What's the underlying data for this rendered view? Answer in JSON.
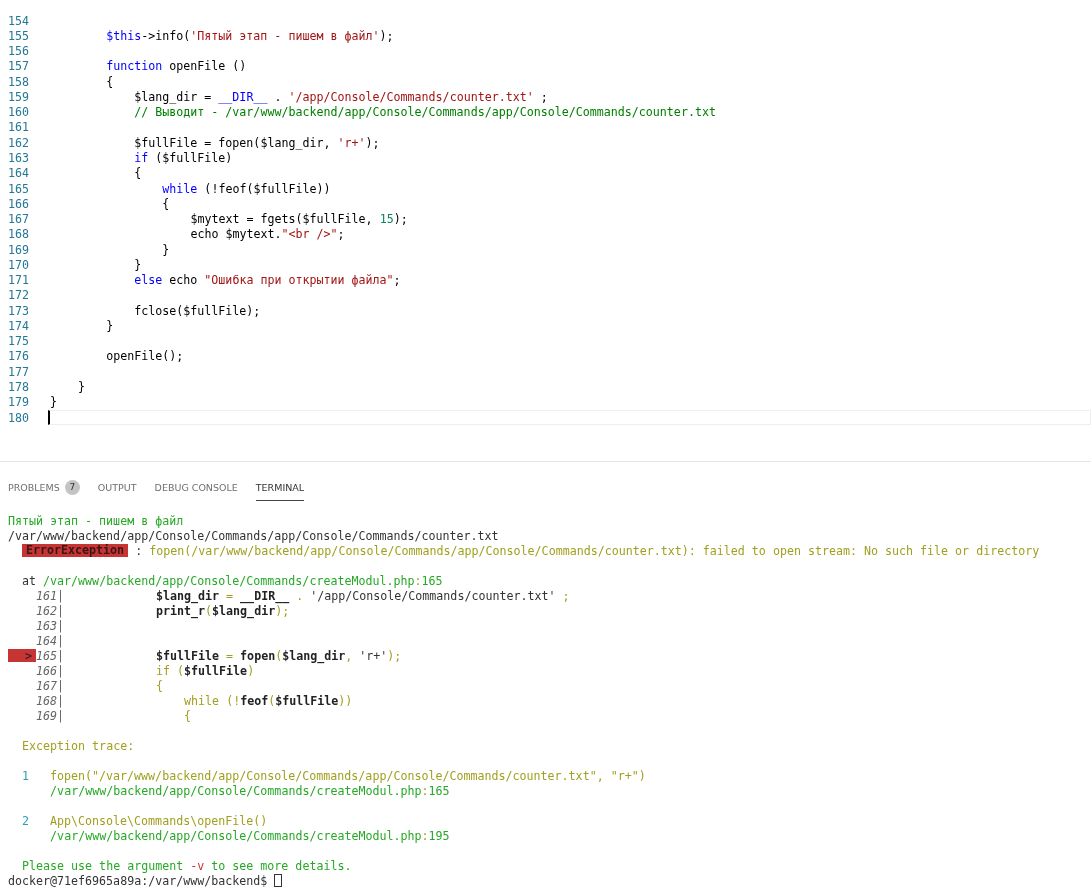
{
  "editor": {
    "lines": [
      {
        "number": "154",
        "current": false
      },
      {
        "number": "155",
        "current": false,
        "tokens": [
          {
            "text": "        $this",
            "kind": "keyword"
          },
          {
            "text": "->info(",
            "kind": "plain"
          },
          {
            "text": "'Пятый этап - пишем в файл'",
            "kind": "string"
          },
          {
            "text": ");",
            "kind": "plain"
          }
        ]
      },
      {
        "number": "156",
        "current": false
      },
      {
        "number": "157",
        "current": false,
        "tokens": [
          {
            "text": "        function",
            "kind": "keyword"
          },
          {
            "text": " openFile ()",
            "kind": "plain"
          }
        ]
      },
      {
        "number": "158",
        "current": false,
        "tokens": [
          {
            "text": "        {",
            "kind": "plain"
          }
        ]
      },
      {
        "number": "159",
        "current": false,
        "tokens": [
          {
            "text": "            $lang_dir = ",
            "kind": "plain"
          },
          {
            "text": "__DIR__",
            "kind": "keyword"
          },
          {
            "text": " . ",
            "kind": "plain"
          },
          {
            "text": "'/app/Console/Commands/counter.txt'",
            "kind": "string"
          },
          {
            "text": " ;",
            "kind": "plain"
          }
        ]
      },
      {
        "number": "160",
        "current": false,
        "tokens": [
          {
            "text": "            // Выводит - /var/www/backend/app/Console/Commands/app/Console/Commands/counter.txt",
            "kind": "comment"
          }
        ]
      },
      {
        "number": "161",
        "current": false
      },
      {
        "number": "162",
        "current": false,
        "tokens": [
          {
            "text": "            $fullFile = fopen($lang_dir, ",
            "kind": "plain"
          },
          {
            "text": "'r+'",
            "kind": "string"
          },
          {
            "text": ");",
            "kind": "plain"
          }
        ]
      },
      {
        "number": "163",
        "current": false,
        "tokens": [
          {
            "text": "            if",
            "kind": "keyword"
          },
          {
            "text": " ($fullFile)",
            "kind": "plain"
          }
        ]
      },
      {
        "number": "164",
        "current": false,
        "tokens": [
          {
            "text": "            {",
            "kind": "plain"
          }
        ]
      },
      {
        "number": "165",
        "current": false,
        "tokens": [
          {
            "text": "                while",
            "kind": "keyword"
          },
          {
            "text": " (!feof($fullFile))",
            "kind": "plain"
          }
        ]
      },
      {
        "number": "166",
        "current": false,
        "tokens": [
          {
            "text": "                {",
            "kind": "plain"
          }
        ]
      },
      {
        "number": "167",
        "current": false,
        "tokens": [
          {
            "text": "                    $mytext = fgets($fullFile, ",
            "kind": "plain"
          },
          {
            "text": "15",
            "kind": "number"
          },
          {
            "text": ");",
            "kind": "plain"
          }
        ]
      },
      {
        "number": "168",
        "current": false,
        "tokens": [
          {
            "text": "                    echo $mytext.",
            "kind": "plain"
          },
          {
            "text": "\"<br />\"",
            "kind": "string"
          },
          {
            "text": ";",
            "kind": "plain"
          }
        ]
      },
      {
        "number": "169",
        "current": false,
        "tokens": [
          {
            "text": "                }",
            "kind": "plain"
          }
        ]
      },
      {
        "number": "170",
        "current": false,
        "tokens": [
          {
            "text": "            }",
            "kind": "plain"
          }
        ]
      },
      {
        "number": "171",
        "current": false,
        "tokens": [
          {
            "text": "            else",
            "kind": "keyword"
          },
          {
            "text": " echo ",
            "kind": "plain"
          },
          {
            "text": "\"Ошибка при открытии файла\"",
            "kind": "string"
          },
          {
            "text": ";",
            "kind": "plain"
          }
        ]
      },
      {
        "number": "172",
        "current": false
      },
      {
        "number": "173",
        "current": false,
        "tokens": [
          {
            "text": "            fclose($fullFile);",
            "kind": "plain"
          }
        ]
      },
      {
        "number": "174",
        "current": false,
        "tokens": [
          {
            "text": "        }",
            "kind": "plain"
          }
        ]
      },
      {
        "number": "175",
        "current": false
      },
      {
        "number": "176",
        "current": false,
        "tokens": [
          {
            "text": "        openFile();",
            "kind": "plain"
          }
        ]
      },
      {
        "number": "177",
        "current": false
      },
      {
        "number": "178",
        "current": false,
        "tokens": [
          {
            "text": "    }",
            "kind": "plain"
          }
        ]
      },
      {
        "number": "179",
        "current": false,
        "tokens": [
          {
            "text": "}",
            "kind": "plain"
          }
        ]
      },
      {
        "number": "180",
        "current": true
      }
    ]
  },
  "panel": {
    "tabs": [
      {
        "label": "PROBLEMS",
        "badge": "7",
        "selected": false
      },
      {
        "label": "OUTPUT",
        "selected": false
      },
      {
        "label": "DEBUG CONSOLE",
        "selected": false
      },
      {
        "label": "TERMINAL",
        "selected": true
      }
    ],
    "terminal": [
      {
        "kind": "text",
        "segments": [
          {
            "text": "Пятый этап - пишем в файл",
            "kind": "green"
          }
        ]
      },
      {
        "kind": "text",
        "segments": [
          {
            "text": "/var/www/backend/app/Console/Commands/app/Console/Commands/counter.txt",
            "kind": "plain"
          }
        ]
      },
      {
        "kind": "error",
        "badge": "ErrorException",
        "segments": [
          {
            "text": " : ",
            "kind": "plain"
          },
          {
            "text": "fopen(/var/www/backend/app/Console/Commands/app/Console/Commands/counter.txt): failed to open stream: No such file or directory",
            "kind": "olive"
          }
        ]
      },
      {
        "kind": "blank"
      },
      {
        "kind": "text",
        "segments": [
          {
            "text": "  at ",
            "kind": "plain"
          },
          {
            "text": "/var/www/backend/app/Console/Commands/createModul.php",
            "kind": "green"
          },
          {
            "text": ":",
            "kind": "olive"
          },
          {
            "text": "165",
            "kind": "green"
          }
        ]
      },
      {
        "kind": "snippet",
        "number": "161|",
        "marker": false,
        "segments": [
          {
            "text": "$lang_dir",
            "kind": "bold"
          },
          {
            "text": " = ",
            "kind": "olive"
          },
          {
            "text": "__DIR__",
            "kind": "bold"
          },
          {
            "text": " . ",
            "kind": "olive"
          },
          {
            "text": "'/app/Console/Commands/counter.txt'",
            "kind": "plain"
          },
          {
            "text": " ;",
            "kind": "olive"
          }
        ]
      },
      {
        "kind": "snippet",
        "number": "162|",
        "marker": false,
        "segments": [
          {
            "text": "print_r",
            "kind": "bold"
          },
          {
            "text": "(",
            "kind": "olive"
          },
          {
            "text": "$lang_dir",
            "kind": "bold"
          },
          {
            "text": ");",
            "kind": "olive"
          }
        ]
      },
      {
        "kind": "snippet",
        "number": "163|",
        "marker": false
      },
      {
        "kind": "snippet",
        "number": "164|",
        "marker": false
      },
      {
        "kind": "snippet",
        "number": "165|",
        "marker": true,
        "markerText": ">",
        "segments": [
          {
            "text": "$fullFile",
            "kind": "bold"
          },
          {
            "text": " = ",
            "kind": "olive"
          },
          {
            "text": "fopen",
            "kind": "bold"
          },
          {
            "text": "(",
            "kind": "olive"
          },
          {
            "text": "$lang_dir",
            "kind": "bold"
          },
          {
            "text": ", ",
            "kind": "olive"
          },
          {
            "text": "'r+'",
            "kind": "plain"
          },
          {
            "text": ");",
            "kind": "olive"
          }
        ]
      },
      {
        "kind": "snippet",
        "number": "166|",
        "marker": false,
        "segments": [
          {
            "text": "if (",
            "kind": "olive"
          },
          {
            "text": "$fullFile",
            "kind": "bold"
          },
          {
            "text": ")",
            "kind": "olive"
          }
        ]
      },
      {
        "kind": "snippet",
        "number": "167|",
        "marker": false,
        "segments": [
          {
            "text": "{",
            "kind": "olive"
          }
        ]
      },
      {
        "kind": "snippet",
        "number": "168|",
        "marker": false,
        "segments": [
          {
            "text": "    while (!",
            "kind": "olive"
          },
          {
            "text": "feof",
            "kind": "bold"
          },
          {
            "text": "(",
            "kind": "olive"
          },
          {
            "text": "$fullFile",
            "kind": "bold"
          },
          {
            "text": "))",
            "kind": "olive"
          }
        ]
      },
      {
        "kind": "snippet",
        "number": "169|",
        "marker": false,
        "segments": [
          {
            "text": "    {",
            "kind": "olive"
          }
        ]
      },
      {
        "kind": "blank"
      },
      {
        "kind": "text",
        "segments": [
          {
            "text": "  Exception trace:",
            "kind": "olive"
          }
        ]
      },
      {
        "kind": "blank"
      },
      {
        "kind": "trace",
        "number": "1",
        "segments": [
          {
            "text": "fopen(\"/var/www/backend/app/Console/Commands/app/Console/Commands/counter.txt\", \"r+\")",
            "kind": "olive"
          }
        ]
      },
      {
        "kind": "text",
        "segments": [
          {
            "text": "      /var/www/backend/app/Console/Commands/createModul.php",
            "kind": "green"
          },
          {
            "text": ":",
            "kind": "olive"
          },
          {
            "text": "165",
            "kind": "green"
          }
        ]
      },
      {
        "kind": "blank"
      },
      {
        "kind": "trace",
        "number": "2",
        "segments": [
          {
            "text": "App\\Console\\Commands\\openFile()",
            "kind": "olive"
          }
        ]
      },
      {
        "kind": "text",
        "segments": [
          {
            "text": "      /var/www/backend/app/Console/Commands/createModul.php",
            "kind": "green"
          },
          {
            "text": ":",
            "kind": "olive"
          },
          {
            "text": "195",
            "kind": "green"
          }
        ]
      },
      {
        "kind": "blank"
      },
      {
        "kind": "text",
        "segments": [
          {
            "text": "  Please use the argument ",
            "kind": "green"
          },
          {
            "text": "-v",
            "kind": "red"
          },
          {
            "text": " to see more details.",
            "kind": "green"
          }
        ]
      },
      {
        "kind": "prompt",
        "text": "docker@71ef6965a89a:/var/www/backend$"
      }
    ]
  }
}
